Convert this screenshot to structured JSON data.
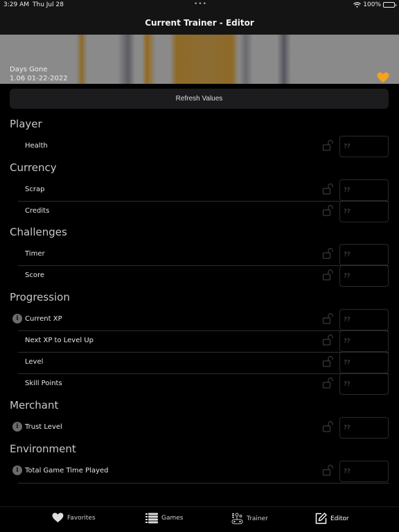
{
  "status_bar": {
    "time": "3:29 AM",
    "date": "Thu Jul 28",
    "multitask_dots": "•••",
    "battery_percent": "100%",
    "battery_level": 1.0
  },
  "nav": {
    "title": "Current Trainer - Editor"
  },
  "banner": {
    "game_name": "Days Gone",
    "game_version": "1.06 01-22-2022",
    "favorite_icon": "heart-filled-icon",
    "favorite_color": "#f5a31a"
  },
  "refresh_button": {
    "label": "Refresh Values"
  },
  "sections": [
    {
      "title": "Player",
      "rows": [
        {
          "label": "Health",
          "info": false,
          "value": "",
          "placeholder": "??",
          "locked": false
        }
      ]
    },
    {
      "title": "Currency",
      "rows": [
        {
          "label": "Scrap",
          "info": false,
          "value": "",
          "placeholder": "??",
          "locked": false
        },
        {
          "label": "Credits",
          "info": false,
          "value": "",
          "placeholder": "??",
          "locked": false
        }
      ]
    },
    {
      "title": "Challenges",
      "rows": [
        {
          "label": "Timer",
          "info": false,
          "value": "",
          "placeholder": "??",
          "locked": false
        },
        {
          "label": "Score",
          "info": false,
          "value": "",
          "placeholder": "??",
          "locked": false
        }
      ]
    },
    {
      "title": "Progression",
      "rows": [
        {
          "label": "Current XP",
          "info": true,
          "value": "",
          "placeholder": "??",
          "locked": false
        },
        {
          "label": "Next XP to Level Up",
          "info": false,
          "value": "",
          "placeholder": "??",
          "locked": false
        },
        {
          "label": "Level",
          "info": false,
          "value": "",
          "placeholder": "??",
          "locked": false
        },
        {
          "label": "Skill Points",
          "info": false,
          "value": "",
          "placeholder": "??",
          "locked": false
        }
      ]
    },
    {
      "title": "Merchant",
      "rows": [
        {
          "label": "Trust Level",
          "info": true,
          "value": "",
          "placeholder": "??",
          "locked": false
        }
      ]
    },
    {
      "title": "Environment",
      "rows": [
        {
          "label": "Total Game Time Played",
          "info": true,
          "value": "",
          "placeholder": "??",
          "locked": false
        }
      ]
    }
  ],
  "info_icon_glyph": "i",
  "tabs": [
    {
      "label": "Favorites",
      "icon": "heart-icon",
      "active": false
    },
    {
      "label": "Games",
      "icon": "list-icon",
      "active": false
    },
    {
      "label": "Trainer",
      "icon": "gamepad-icon",
      "active": false
    },
    {
      "label": "Editor",
      "icon": "edit-icon",
      "active": true
    }
  ]
}
